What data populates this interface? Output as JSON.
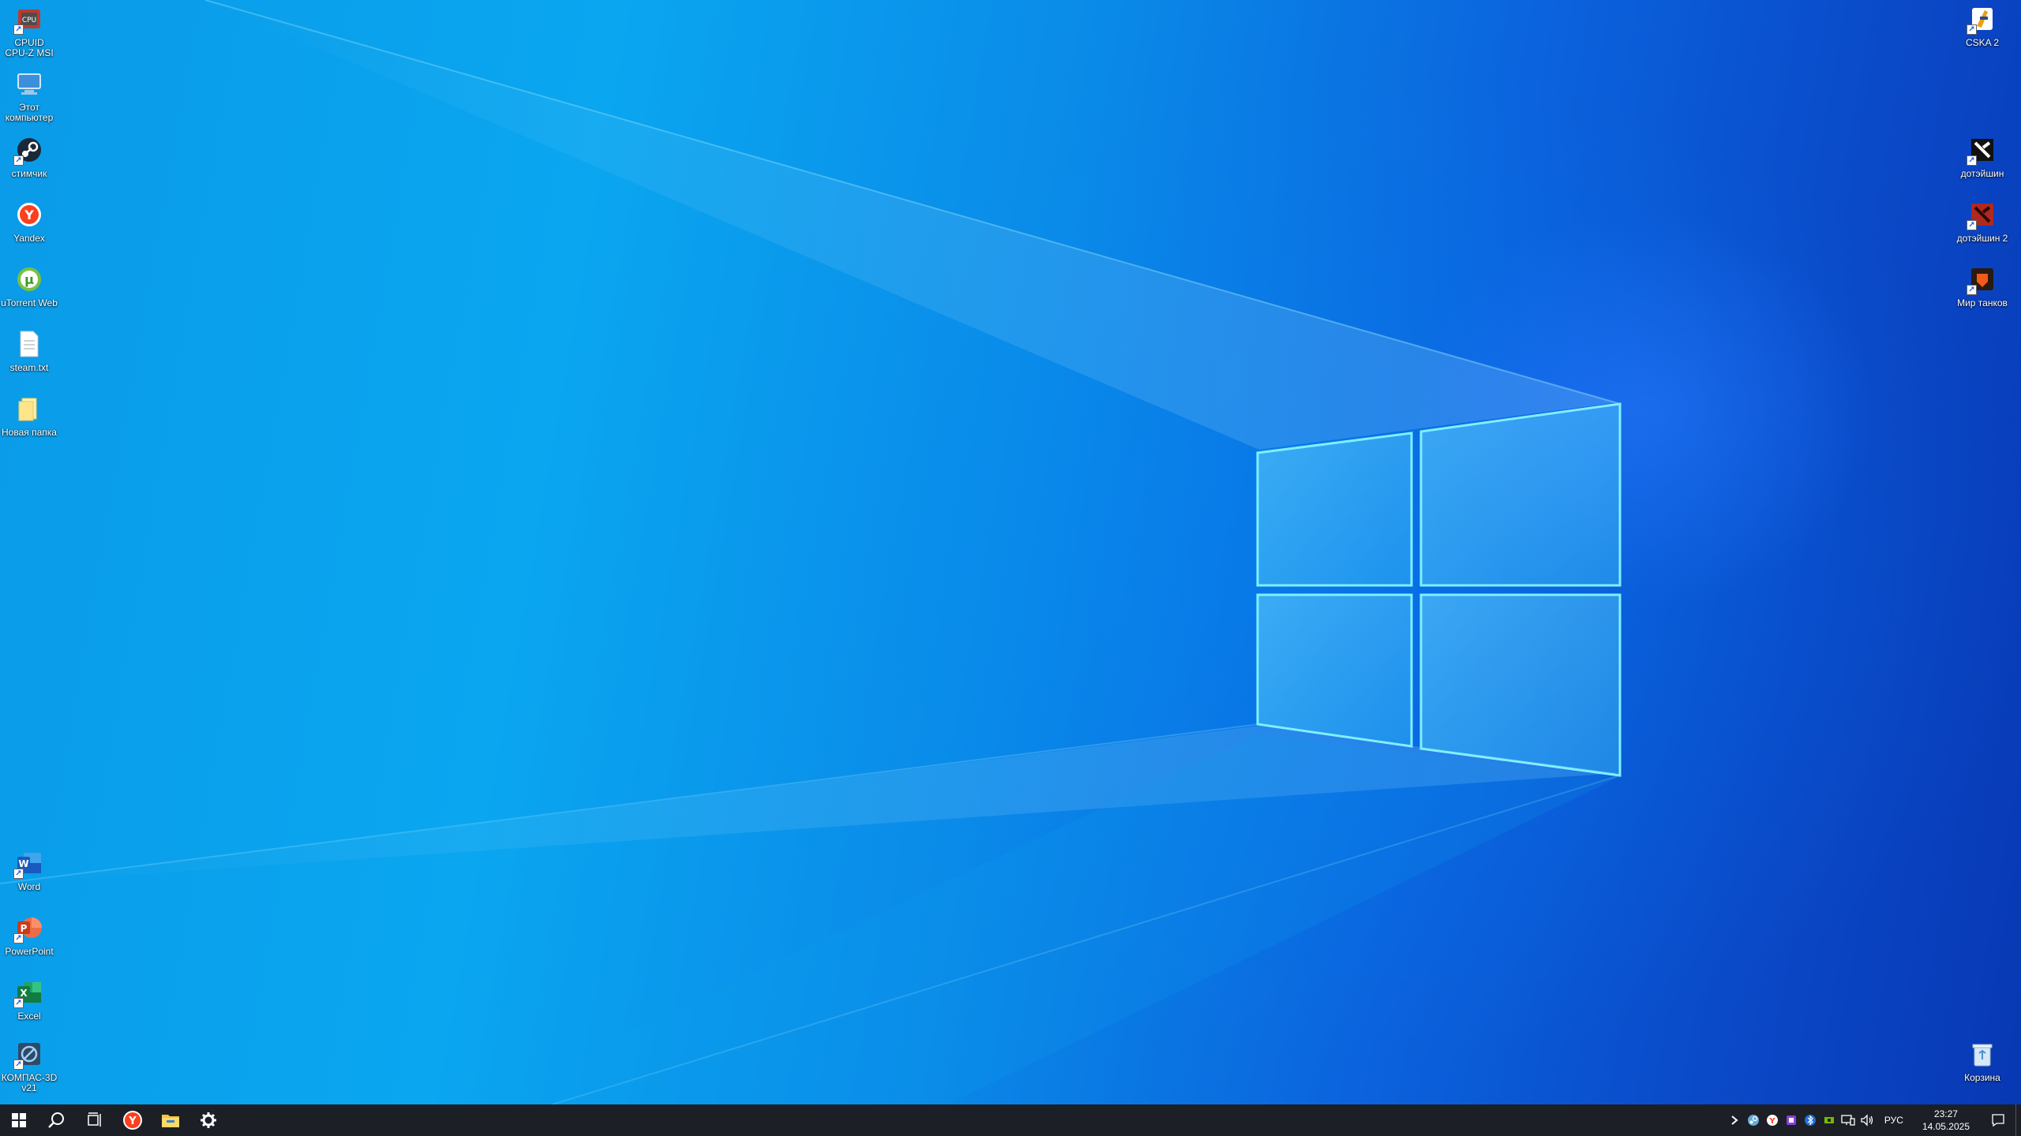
{
  "desktop": {
    "icons_left": [
      {
        "name": "cpuz-shortcut",
        "label": "CPUID\nCPU-Z MSI",
        "icon": "cpuz-icon"
      },
      {
        "name": "this-pc",
        "label": "Этот\nкомпьютер",
        "icon": "computer-icon"
      },
      {
        "name": "steam-shortcut",
        "label": "стимчик",
        "icon": "steam-icon"
      },
      {
        "name": "yandex-shortcut",
        "label": "Yandex",
        "icon": "yandex-icon"
      },
      {
        "name": "utorrent-web-shortcut",
        "label": "uTorrent Web",
        "icon": "utorrent-icon"
      },
      {
        "name": "steam-txt-file",
        "label": "steam.txt",
        "icon": "text-file-icon"
      },
      {
        "name": "new-folder",
        "label": "Новая папка",
        "icon": "folder-icon"
      },
      {
        "name": "word-shortcut",
        "label": "Word",
        "icon": "word-icon"
      },
      {
        "name": "powerpoint-shortcut",
        "label": "PowerPoint",
        "icon": "powerpoint-icon"
      },
      {
        "name": "excel-shortcut",
        "label": "Excel",
        "icon": "excel-icon"
      },
      {
        "name": "kompas-shortcut",
        "label": "КОМПАС-3D\nv21",
        "icon": "kompas-icon"
      }
    ],
    "icons_right": [
      {
        "name": "cska2-shortcut",
        "label": "CSKA 2",
        "icon": "cska-icon"
      },
      {
        "name": "dota-shortcut",
        "label": "дотэйшин",
        "icon": "dota-icon"
      },
      {
        "name": "dota2-shortcut",
        "label": "дотэйшин 2",
        "icon": "dota2-icon"
      },
      {
        "name": "world-of-tanks-shortcut",
        "label": "Мир танков",
        "icon": "tanks-icon"
      },
      {
        "name": "recycle-bin",
        "label": "Корзина",
        "icon": "recycle-bin-icon"
      }
    ]
  },
  "taskbar": {
    "pinned": [
      {
        "name": "start-button",
        "icon": "windows-logo-icon"
      },
      {
        "name": "search-button",
        "icon": "search-icon"
      },
      {
        "name": "task-view-button",
        "icon": "task-view-icon"
      },
      {
        "name": "yandex-taskbar-button",
        "icon": "yandex-icon"
      },
      {
        "name": "file-explorer-taskbar-button",
        "icon": "folder-icon"
      },
      {
        "name": "settings-taskbar-button",
        "icon": "gear-icon"
      }
    ],
    "tray": {
      "icons": [
        "chevron-right-icon",
        "steam-icon",
        "yandex-icon",
        "app-icon",
        "bluetooth-icon",
        "nvidia-icon",
        "network-icon",
        "volume-icon"
      ],
      "language": "РУС",
      "time": "23:27",
      "date": "14.05.2025"
    }
  },
  "colors": {
    "taskbar": "#1c1f26",
    "wallpaper_light": "#0aa6f0",
    "wallpaper_dark": "#0838b4",
    "accent": "#76b9ed"
  }
}
